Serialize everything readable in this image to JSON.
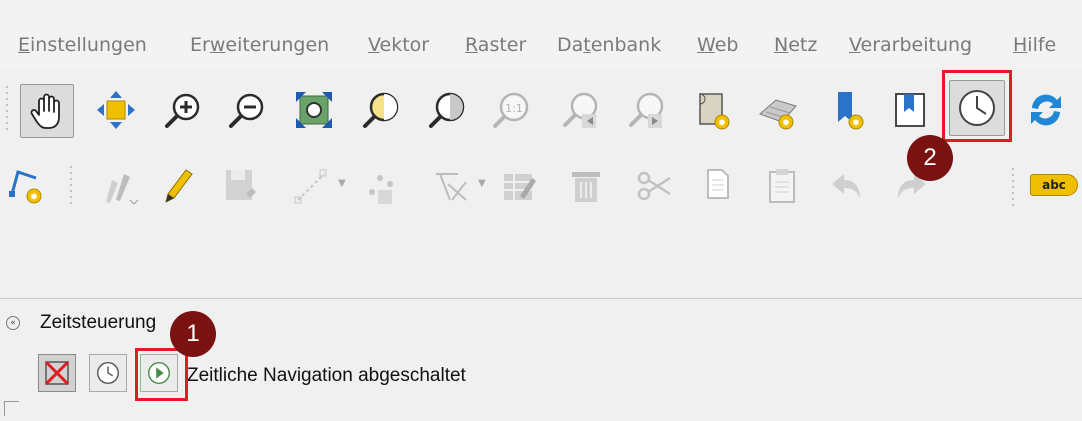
{
  "menu": {
    "items": [
      {
        "pre": "",
        "u": "E",
        "post": "instellungen"
      },
      {
        "pre": "Er",
        "u": "w",
        "post": "eiterungen"
      },
      {
        "pre": "",
        "u": "V",
        "post": "ektor"
      },
      {
        "pre": "",
        "u": "R",
        "post": "aster"
      },
      {
        "pre": "Da",
        "u": "t",
        "post": "enbank"
      },
      {
        "pre": "",
        "u": "W",
        "post": "eb"
      },
      {
        "pre": "",
        "u": "N",
        "post": "etz"
      },
      {
        "pre": "",
        "u": "V",
        "post": "erarbeitung"
      },
      {
        "pre": "",
        "u": "H",
        "post": "ilfe"
      }
    ]
  },
  "toolbar2": {
    "label_tool_text": "abc"
  },
  "annotations": {
    "badge1": "1",
    "badge2": "2"
  },
  "panel": {
    "title": "Zeitsteuerung",
    "status": "Zeitliche Navigation abgeschaltet"
  },
  "colors": {
    "highlight": "#e01c24",
    "badge": "#7a1212",
    "accent_blue": "#1e88d6",
    "accent_yellow": "#f0c000"
  }
}
